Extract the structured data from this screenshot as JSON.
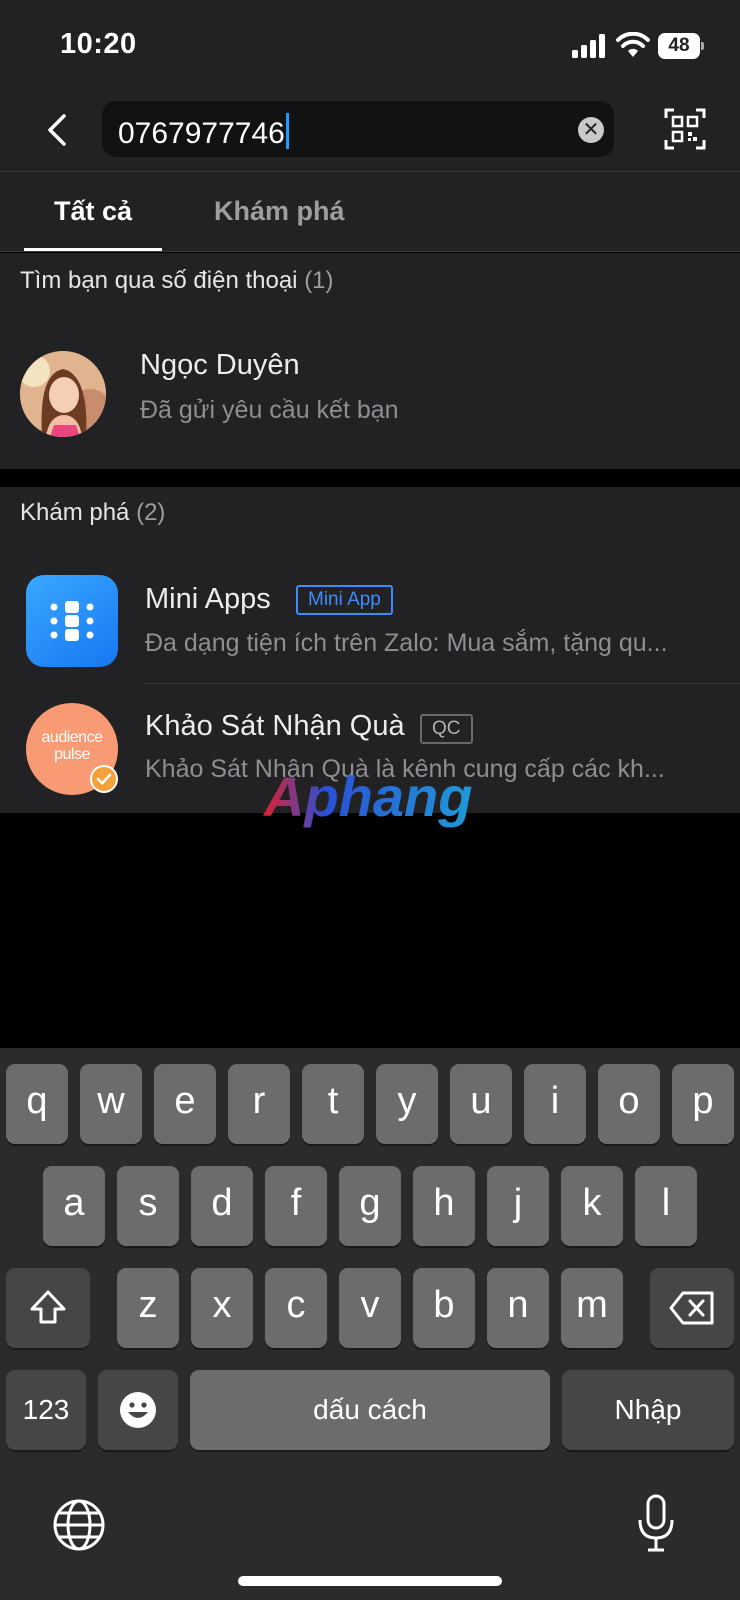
{
  "status_bar": {
    "time": "10:20",
    "battery_level": "48"
  },
  "search": {
    "value": "0767977746",
    "clear_label": "✕"
  },
  "tabs": [
    {
      "label": "Tất cả",
      "active": true
    },
    {
      "label": "Khám phá",
      "active": false
    }
  ],
  "phone_section": {
    "title": "Tìm bạn qua số điện thoại",
    "count": "(1)",
    "result": {
      "name": "Ngọc Duyên",
      "status": "Đã gửi yêu cầu kết bạn"
    }
  },
  "explore_section": {
    "title": "Khám phá",
    "count": "(2)",
    "items": [
      {
        "name": "Mini Apps",
        "tag": "Mini App",
        "description": "Đa dạng tiện ích trên Zalo: Mua sắm, tặng qu..."
      },
      {
        "name": "Khảo Sát Nhận Quà",
        "tag": "QC",
        "description": "Khảo Sát Nhận Quà là kênh cung cấp các kh...",
        "logo_text": [
          "audience",
          "pulse"
        ]
      }
    ]
  },
  "watermark": "Aphang",
  "keyboard": {
    "row1": [
      "q",
      "w",
      "e",
      "r",
      "t",
      "y",
      "u",
      "i",
      "o",
      "p"
    ],
    "row2": [
      "a",
      "s",
      "d",
      "f",
      "g",
      "h",
      "j",
      "k",
      "l"
    ],
    "row3": [
      "z",
      "x",
      "c",
      "v",
      "b",
      "n",
      "m"
    ],
    "numbers_label": "123",
    "space_label": "dấu cách",
    "return_label": "Nhập"
  },
  "colors": {
    "accent_blue": "#1e9bff",
    "mini_app_tag": "#3d8cff",
    "audience_orange": "#f89a73",
    "panel_bg": "#222224"
  },
  "icons": [
    "back-icon",
    "clear-icon",
    "qr-scan-icon",
    "mini-apps-grid-icon",
    "verified-badge-icon",
    "shift-icon",
    "backspace-icon",
    "emoji-icon",
    "globe-icon",
    "microphone-icon"
  ]
}
